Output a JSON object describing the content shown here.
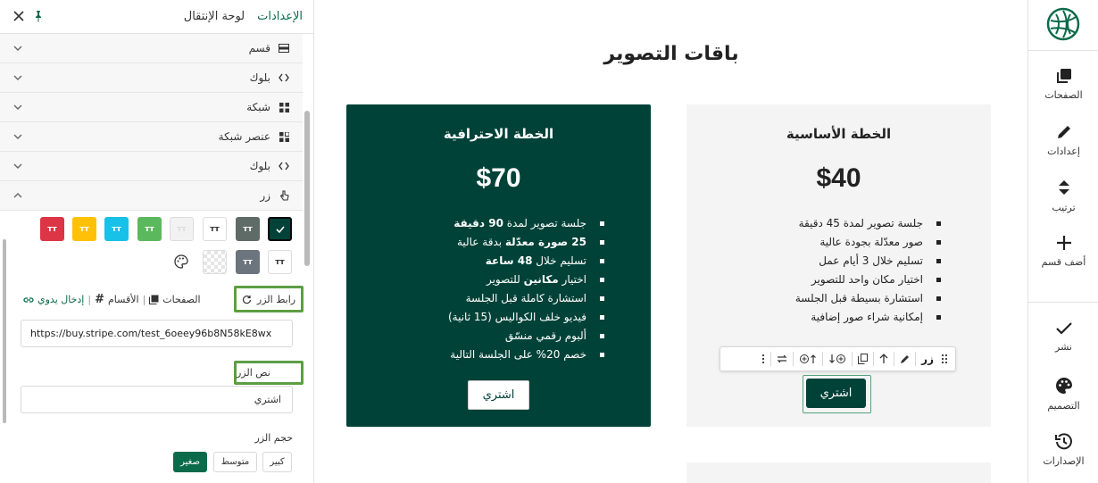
{
  "rail": {
    "items": [
      {
        "label": "الصفحات",
        "icon": "pages-icon"
      },
      {
        "label": "إعدادات",
        "icon": "pencil-icon"
      },
      {
        "label": "ترتيب",
        "icon": "sort-icon"
      },
      {
        "label": "أضف قسم",
        "icon": "plus-icon"
      },
      {
        "label": "نشر",
        "icon": "check-icon"
      },
      {
        "label": "التصميم",
        "icon": "palette-icon"
      },
      {
        "label": "الإصدارات",
        "icon": "history-icon"
      }
    ]
  },
  "panel": {
    "tabs": [
      {
        "label": "الإعدادات",
        "active": true
      },
      {
        "label": "لوحة الإنتقال",
        "active": false
      }
    ],
    "tree": [
      {
        "label": "قسم",
        "icon": "section-icon",
        "expanded": false
      },
      {
        "label": "بلوك",
        "icon": "block-icon",
        "expanded": false
      },
      {
        "label": "شبكة",
        "icon": "grid-icon",
        "expanded": false
      },
      {
        "label": "عنصر شبكة",
        "icon": "grid-item-icon",
        "expanded": false
      },
      {
        "label": "بلوك",
        "icon": "block-icon",
        "expanded": false
      },
      {
        "label": "زر",
        "icon": "button-icon",
        "expanded": true
      }
    ],
    "button_settings": {
      "swatch_glyph": "ᴛᴛ",
      "swatch_colors": [
        "#004238",
        "#5f6b66",
        "#ffffff",
        "#f2f2f2",
        "#5cb85c",
        "#17c1e8",
        "#ffc107",
        "#dc3545",
        "#6c757d",
        "#ffffff"
      ],
      "link_label": "رابط الزر",
      "link_options": {
        "pages": "الصفحات",
        "sections": "الأقسام",
        "manual": "إدخال يدوي",
        "separator": "|"
      },
      "url_value": "https://buy.stripe.com/test_6oeey96b8N58kE8wx",
      "text_label": "نص الزر",
      "text_value": "اشتري",
      "size_label": "حجم الزر",
      "sizes": [
        {
          "label": "كبير",
          "active": false
        },
        {
          "label": "متوسط",
          "active": false
        },
        {
          "label": "صغير",
          "active": true
        }
      ]
    }
  },
  "canvas": {
    "page_title": "باقات التصوير",
    "cards": {
      "pro": {
        "title": "الخطة الاحترافية",
        "price": "$70",
        "features": [
          {
            "pre": "جلسة تصوير لمدة ",
            "bold": "90 دقيقة",
            "post": ""
          },
          {
            "pre": "",
            "bold": "25 صورة معدّلة",
            "post": " بدقة عالية"
          },
          {
            "pre": "تسليم خلال ",
            "bold": "48 ساعة",
            "post": ""
          },
          {
            "pre": "اختيار ",
            "bold": "مكانين",
            "post": " للتصوير"
          },
          {
            "pre": "استشارة كاملة قبل الجلسة",
            "bold": "",
            "post": ""
          },
          {
            "pre": "فيديو خلف الكواليس (15 ثانية)",
            "bold": "",
            "post": ""
          },
          {
            "pre": "ألبوم رقمي منسّق",
            "bold": "",
            "post": ""
          },
          {
            "pre": "خصم 20% على الجلسة التالية",
            "bold": "",
            "post": ""
          }
        ],
        "button": "اشتري"
      },
      "basic": {
        "title": "الخطة الأساسية",
        "price": "$40",
        "features": [
          "جلسة تصوير لمدة 45 دقيقة",
          "صور معدّلة بجودة عالية",
          "تسليم خلال 3 أيام عمل",
          "اختيار مكان واحد للتصوير",
          "استشارة بسيطة قبل الجلسة",
          "إمكانية شراء صور إضافية"
        ],
        "button": "اشتري"
      }
    },
    "toolbar": {
      "label": "زر",
      "items": [
        "drag-handle-icon",
        "pencil-icon",
        "arrow-up-icon",
        "copy-icon",
        "insert-below-icon",
        "insert-above-icon",
        "swap-icon",
        "more-icon"
      ]
    }
  },
  "colors": {
    "accent": "#0a6b4a",
    "card_dark": "#004238",
    "card_light": "#f4f4f4",
    "highlight": "#5c9e44"
  }
}
